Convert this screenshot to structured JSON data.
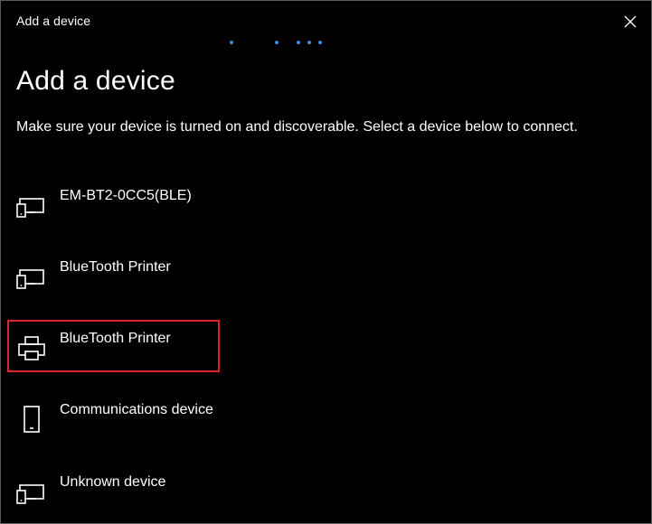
{
  "window": {
    "title": "Add a device",
    "close_icon": "close-icon"
  },
  "progress": {
    "indicator": "indeterminate-dots",
    "color": "#3a8bd8"
  },
  "main": {
    "heading": "Add a device",
    "description": "Make sure your device is turned on and discoverable. Select a device below to connect."
  },
  "devices": [
    {
      "label": "EM-BT2-0CC5(BLE)",
      "icon": "generic-device-icon"
    },
    {
      "label": "BlueTooth Printer",
      "icon": "generic-device-icon"
    },
    {
      "label": "BlueTooth Printer",
      "icon": "printer-icon",
      "highlighted": true
    },
    {
      "label": "Communications device",
      "icon": "phone-icon"
    },
    {
      "label": "Unknown device",
      "icon": "generic-device-icon"
    }
  ],
  "colors": {
    "background": "#000000",
    "text": "#ffffff",
    "accent": "#3a8bd8",
    "highlight_border": "#d8262e"
  }
}
